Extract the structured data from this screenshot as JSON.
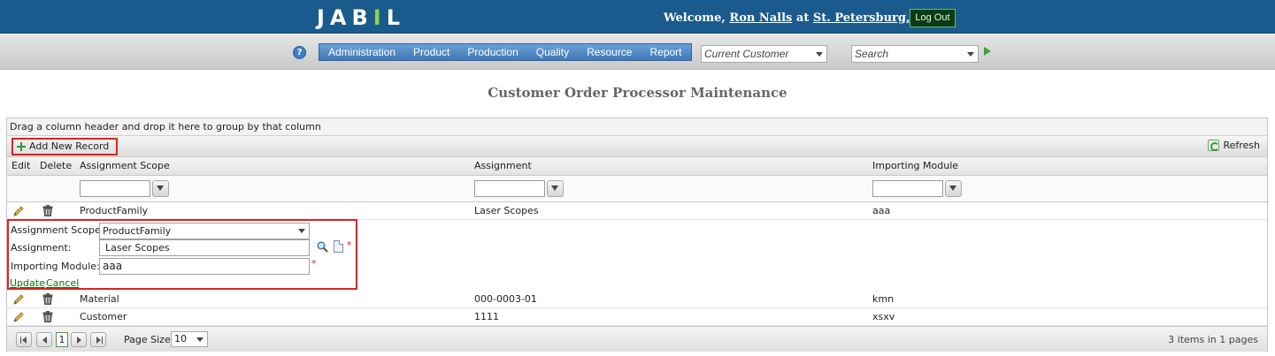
{
  "header": {
    "logo": "JABIL",
    "welcome_prefix": "Welcome,",
    "user_name": "Ron Nalls",
    "at": "at",
    "location": "St. Petersburg, FL",
    "logout": "Log Out"
  },
  "nav": {
    "help_icon": "help-circle-icon",
    "menu": [
      "Administration",
      "Product",
      "Production",
      "Quality",
      "Resource",
      "Report"
    ],
    "customer_select": "Current Customer",
    "search_placeholder": "Search",
    "go_icon": "green-arrow-right-icon"
  },
  "page_title": "Customer Order Processor Maintenance",
  "grid": {
    "group_hint": "Drag a column header and drop it here to group by that column",
    "add_new_record": "Add New Record",
    "refresh": "Refresh",
    "columns": [
      "Edit",
      "Delete",
      "Assignment Scope",
      "Assignment",
      "Importing Module"
    ],
    "rows": [
      {
        "scope": "ProductFamily",
        "assignment": "Laser Scopes",
        "module": "aaa"
      },
      {
        "scope": "Material",
        "assignment": "000-0003-01",
        "module": "kmn"
      },
      {
        "scope": "Customer",
        "assignment": "1111",
        "module": "xsxv"
      }
    ],
    "edit_form": {
      "scope_label": "Assignment Scope:",
      "scope_value": "ProductFamily",
      "assignment_label": "Assignment:",
      "assignment_value": "Laser Scopes",
      "module_label": "Importing Module:",
      "module_value": "aaa",
      "required_mark": "*",
      "update": "Update",
      "cancel": "Cancel"
    },
    "pager": {
      "current_page": "1",
      "page_size_label": "Page Size:",
      "page_size": "10",
      "items_count": "3",
      "items_in": "items in",
      "pages_count": "1",
      "pages_label": "pages"
    }
  },
  "colors": {
    "header_bg": "#1a5a8c",
    "menu_bg": "#4f88c6",
    "highlight_border": "#e0201f"
  }
}
